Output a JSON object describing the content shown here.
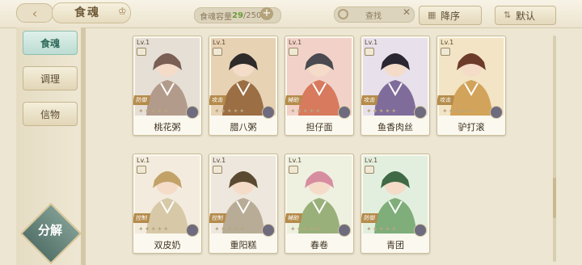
{
  "header": {
    "title": "食魂",
    "capacity_label": "食魂容量",
    "capacity_current": "29",
    "capacity_total": "/250",
    "search_placeholder": "查找",
    "sort_desc": "降序",
    "sort_default": "默认"
  },
  "sidebar": {
    "tabs": [
      "食魂",
      "调理",
      "信物"
    ],
    "decompose_label": "分解"
  },
  "cards": [
    {
      "level": "Lv.1",
      "role": "防御",
      "name": "桃花粥",
      "palette": [
        "#e6dfd6",
        "#b39b8b",
        "#7a5f55"
      ]
    },
    {
      "level": "Lv.1",
      "role": "攻击",
      "name": "腊八粥",
      "palette": [
        "#e7d2b4",
        "#9b6e43",
        "#2f2b2b"
      ]
    },
    {
      "level": "Lv.1",
      "role": "辅助",
      "name": "担仔面",
      "palette": [
        "#f2d2c8",
        "#d77a5d",
        "#4a4a50"
      ]
    },
    {
      "level": "Lv.1",
      "role": "攻击",
      "name": "鱼香肉丝",
      "palette": [
        "#e8e0ea",
        "#7f6c9b",
        "#2a2732"
      ]
    },
    {
      "level": "Lv.1",
      "role": "攻击",
      "name": "驴打滚",
      "palette": [
        "#f2e4c4",
        "#d2a35a",
        "#6d3b2a"
      ]
    },
    {
      "level": "Lv.1",
      "role": "控制",
      "name": "双皮奶",
      "palette": [
        "#f3ecde",
        "#d7c9a8",
        "#c2a267"
      ]
    },
    {
      "level": "Lv.1",
      "role": "控制",
      "name": "重阳糕",
      "palette": [
        "#ede7de",
        "#b9ac96",
        "#5b4a32"
      ]
    },
    {
      "level": "Lv.1",
      "role": "辅助",
      "name": "春卷",
      "palette": [
        "#eef0e0",
        "#9ab07a",
        "#d78da0"
      ]
    },
    {
      "level": "Lv.1",
      "role": "防御",
      "name": "青团",
      "palette": [
        "#e3efde",
        "#7fae7a",
        "#3f6a45"
      ]
    }
  ],
  "colors": {
    "accent": "#b58b4b",
    "active_tab": "#bcdcd2",
    "background": "#ece6d3"
  }
}
